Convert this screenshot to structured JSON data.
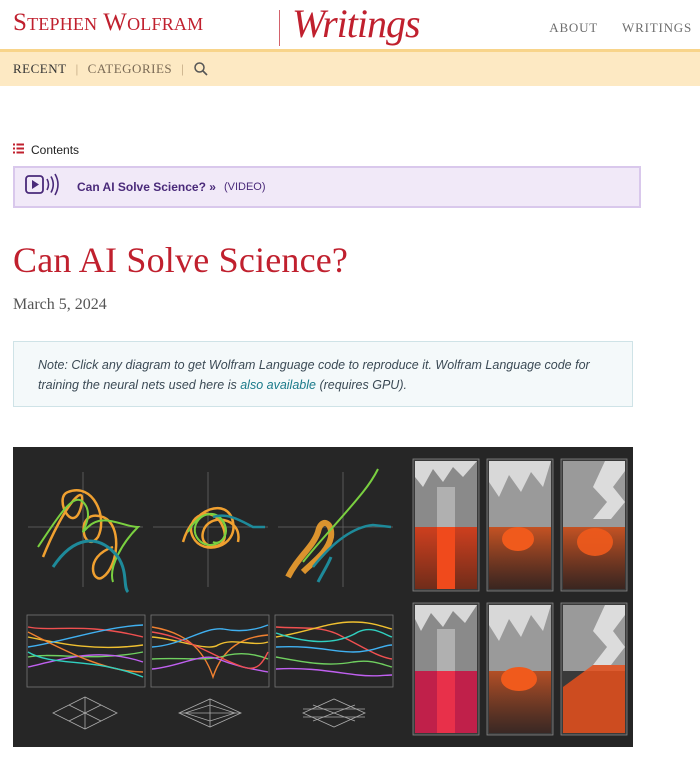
{
  "header": {
    "brand": "Stephen Wolfram",
    "section_script": "Writings",
    "nav": [
      "ABOUT",
      "WRITINGS"
    ]
  },
  "subnav": {
    "items": [
      "RECENT",
      "CATEGORIES"
    ],
    "active": "RECENT",
    "search_icon": "search-icon"
  },
  "contents": {
    "label": "Contents",
    "icon": "list-icon"
  },
  "video": {
    "title": "Can AI Solve Science? »",
    "tag": "(VIDEO)",
    "icon": "video-play-icon"
  },
  "article": {
    "title": "Can AI Solve Science?",
    "date": "March 5, 2024"
  },
  "note": {
    "text_before": "Note: Click any diagram to get Wolfram Language code to reproduce it. Wolfram Language code for training the neural nets used here is ",
    "link": "also available",
    "text_after": " (requires GPU)."
  },
  "colors": {
    "brand_red": "#c0202e",
    "subbar_bg": "#fde9c3",
    "video_bg": "#f1e9f8",
    "video_text": "#4a2a7a",
    "note_link": "#1a7a8a",
    "figure_bg": "#262626"
  }
}
